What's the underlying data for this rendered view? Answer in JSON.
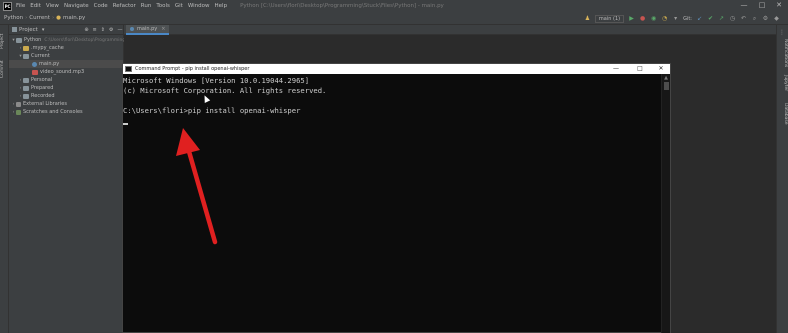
{
  "menubar": {
    "logo_text": "PC",
    "items": [
      "File",
      "Edit",
      "View",
      "Navigate",
      "Code",
      "Refactor",
      "Run",
      "Tools",
      "Git",
      "Window",
      "Help"
    ],
    "window_title": "Python [C:\\Users\\flori\\Desktop\\Programming\\Stuck\\Files\\Python] - main.py",
    "controls": [
      "—",
      "□",
      "✕"
    ]
  },
  "navbar": {
    "breadcrumbs": [
      "Python",
      "Current",
      "main.py"
    ],
    "run_config": "main (1)",
    "git_label": "Git:"
  },
  "left_strip": {
    "tabs": [
      "Project",
      "Commit"
    ]
  },
  "project_panel": {
    "title": "Project",
    "tree": [
      {
        "label": "Python",
        "path": "C:\\Users\\flori\\Desktop\\Programming\\...",
        "icon": "folder-icon",
        "expanded": true
      },
      {
        "label": ".mypy_cache",
        "path": "",
        "icon": "folder-icon",
        "expanded": false
      },
      {
        "label": "Current",
        "path": "",
        "icon": "folder-icon",
        "expanded": true
      },
      {
        "label": "main.py",
        "path": "",
        "icon": "python-file-icon",
        "selected": true
      },
      {
        "label": "video_sound.mp3",
        "path": "",
        "icon": "audio-file-icon"
      },
      {
        "label": "Personal",
        "path": "",
        "icon": "folder-icon",
        "expanded": false
      },
      {
        "label": "Prepared",
        "path": "",
        "icon": "folder-icon",
        "expanded": false
      },
      {
        "label": "Recorded",
        "path": "",
        "icon": "folder-icon",
        "expanded": false
      },
      {
        "label": "External Libraries",
        "path": "",
        "icon": "library-icon",
        "expanded": false
      },
      {
        "label": "Scratches and Consoles",
        "path": "",
        "icon": "scratch-icon",
        "expanded": false
      }
    ]
  },
  "editor": {
    "tab_label": "main.py",
    "tab_close": "×"
  },
  "right_strip": {
    "tabs": [
      "Notifications",
      "Jupyter",
      "Database"
    ]
  },
  "cmd": {
    "title": "Command Prompt - pip  install openai-whisper",
    "controls": [
      "—",
      "□",
      "✕"
    ],
    "lines": [
      "Microsoft Windows [Version 10.0.19044.2965]",
      "(c) Microsoft Corporation. All rights reserved.",
      "",
      "C:\\Users\\flori>pip install openai-whisper"
    ],
    "scroll_up": "▲"
  },
  "colors": {
    "ide_background": "#2b2b2b",
    "panel": "#3c3f41",
    "terminal_background": "#0c0c0c",
    "terminal_text": "#cccccc",
    "annotation_arrow": "#e02020",
    "tab_accent": "#4a88c7"
  }
}
